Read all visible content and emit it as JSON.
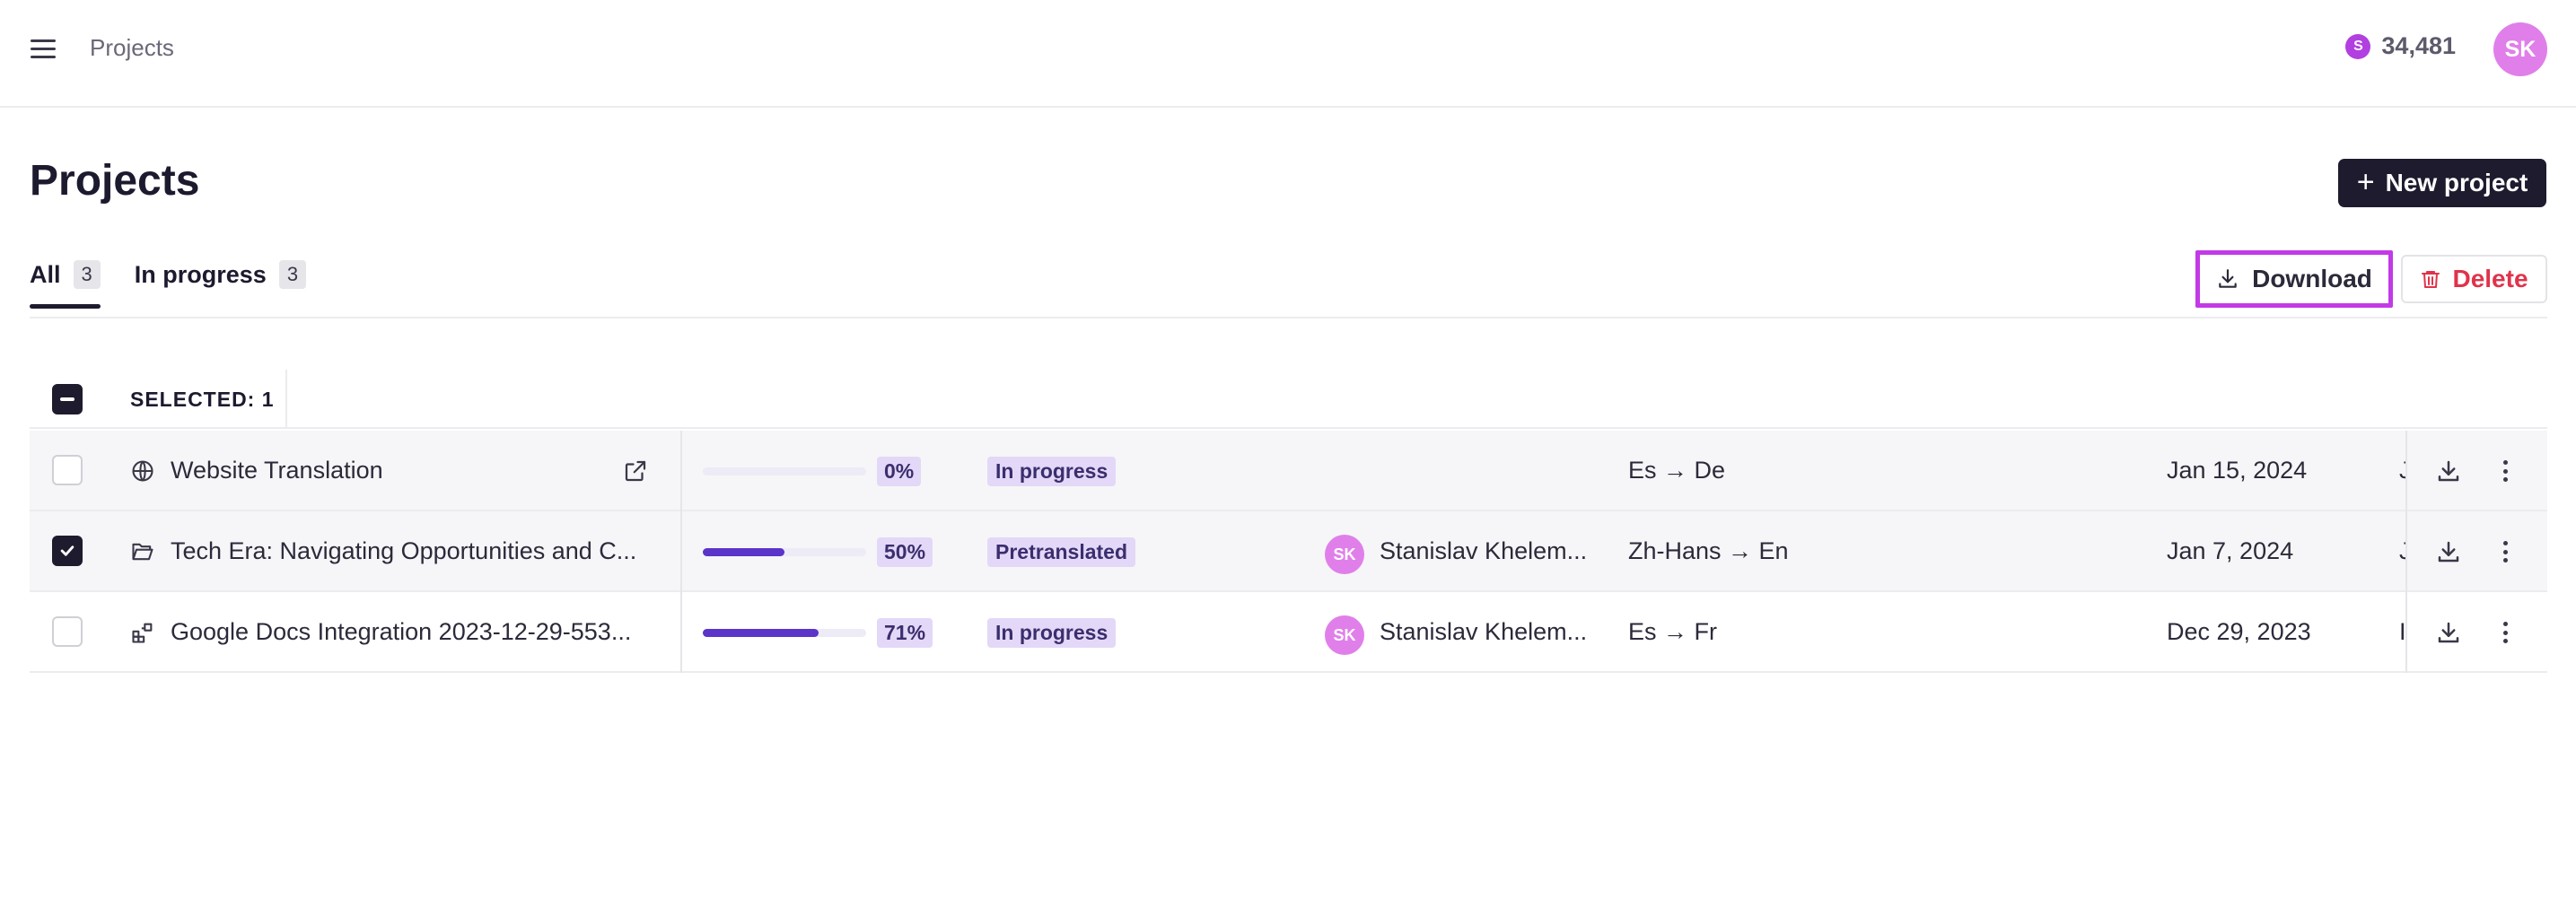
{
  "header": {
    "breadcrumb": "Projects",
    "credits": "34,481",
    "credit_symbol": "S",
    "avatar_initials": "SK"
  },
  "page": {
    "title": "Projects",
    "new_project_label": "New project"
  },
  "tabs": [
    {
      "label": "All",
      "count": "3",
      "active": true
    },
    {
      "label": "In progress",
      "count": "3",
      "active": false
    }
  ],
  "actions": {
    "download_label": "Download",
    "delete_label": "Delete"
  },
  "selection": {
    "label": "SELECTED: 1"
  },
  "rows": [
    {
      "name": "Website Translation",
      "icon": "globe-icon",
      "checked": false,
      "progress": 0,
      "progress_label": "0%",
      "status": "In progress",
      "assignee_initials": "",
      "assignee": "",
      "languages": "Es → De",
      "date": "Jan 15, 2024",
      "overflow_text": "J"
    },
    {
      "name": "Tech Era: Navigating Opportunities and C...",
      "icon": "folder-open-icon",
      "checked": true,
      "progress": 50,
      "progress_label": "50%",
      "status": "Pretranslated",
      "assignee_initials": "SK",
      "assignee": "Stanislav Khelem...",
      "languages": "Zh-Hans → En",
      "date": "Jan 7, 2024",
      "overflow_text": "J"
    },
    {
      "name": "Google Docs Integration 2023-12-29-553...",
      "icon": "integration-icon",
      "checked": false,
      "progress": 71,
      "progress_label": "71%",
      "status": "In progress",
      "assignee_initials": "SK",
      "assignee": "Stanislav Khelem...",
      "languages": "Es → Fr",
      "date": "Dec 29, 2023",
      "overflow_text": "I"
    }
  ],
  "colors": {
    "accent": "#5b34c9",
    "highlight": "#c23ae6",
    "danger": "#e0334b",
    "avatar": "#e07fea"
  }
}
